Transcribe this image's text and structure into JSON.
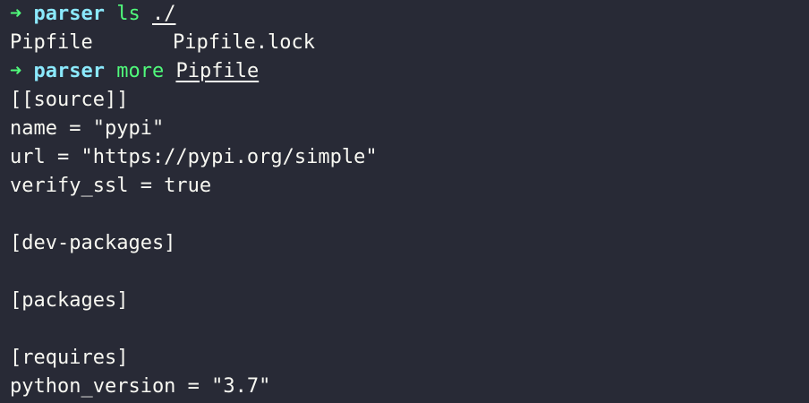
{
  "colors": {
    "background": "#282a36",
    "text": "#f8f8f2",
    "prompt_arrow": "#50fa7b",
    "prompt_dir": "#8be9fd",
    "command": "#50fa7b"
  },
  "icons": {
    "prompt_arrow": "arrow-right-icon"
  },
  "commands": [
    {
      "arrow": "➜",
      "dir": "parser",
      "cmd": "ls",
      "arg": "./"
    },
    {
      "arrow": "➜",
      "dir": "parser",
      "cmd": "more",
      "arg": "Pipfile"
    }
  ],
  "ls_output": [
    "Pipfile",
    "Pipfile.lock"
  ],
  "file_lines": [
    "[[source]]",
    "name = \"pypi\"",
    "url = \"https://pypi.org/simple\"",
    "verify_ssl = true",
    "",
    "[dev-packages]",
    "",
    "[packages]",
    "",
    "[requires]",
    "python_version = \"3.7\""
  ]
}
